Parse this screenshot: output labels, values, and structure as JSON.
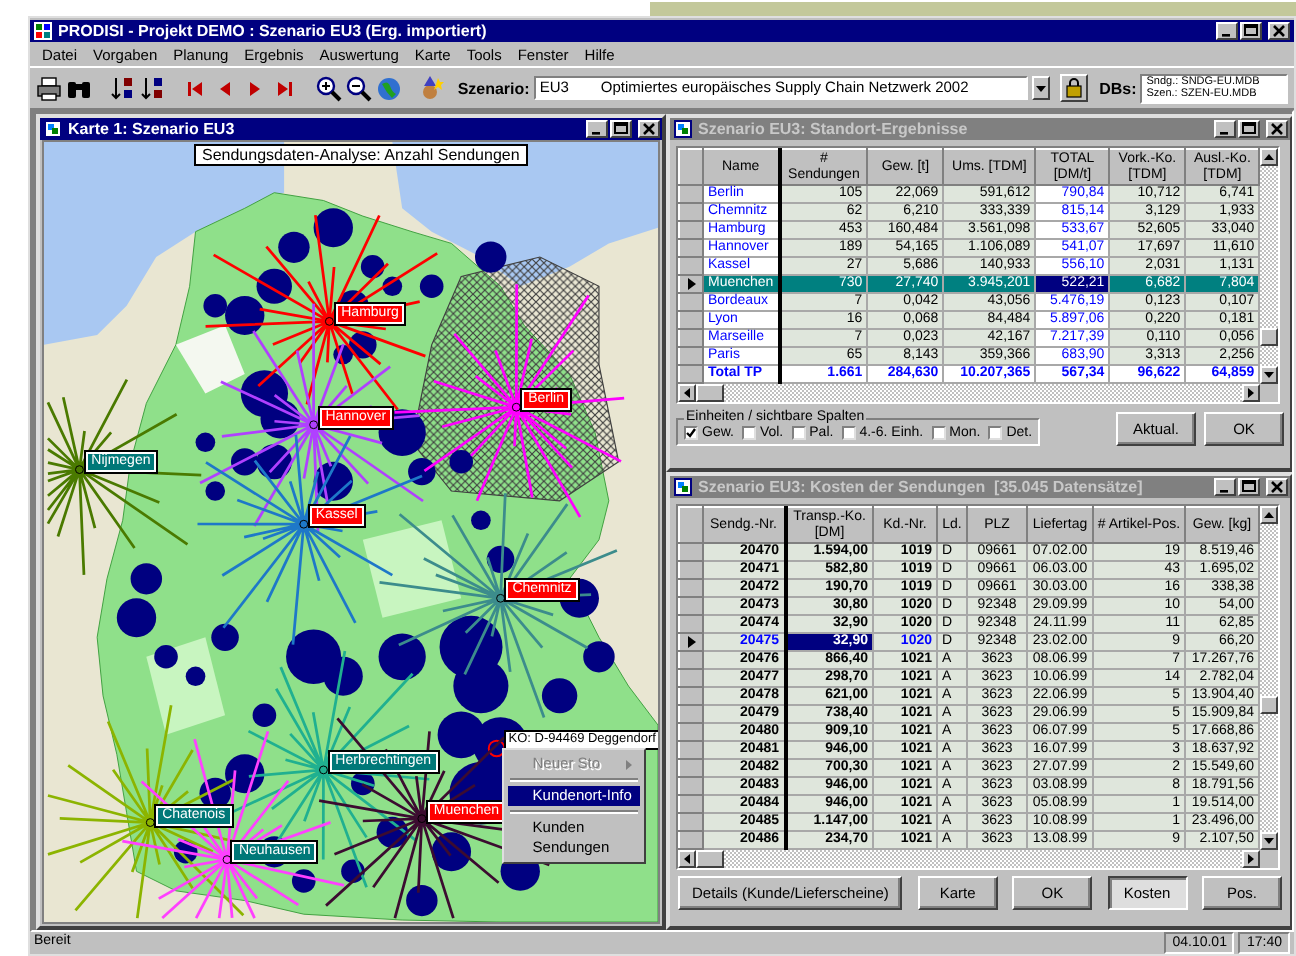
{
  "app": {
    "title": "PRODISI - Projekt DEMO : Szenario EU3 (Erg. importiert)"
  },
  "menu": [
    "Datei",
    "Vorgaben",
    "Planung",
    "Ergebnis",
    "Auswertung",
    "Karte",
    "Tools",
    "Fenster",
    "Hilfe"
  ],
  "toolbar": {
    "scenario_label": "Szenario:",
    "scenario_code": "EU3",
    "scenario_name": "Optimiertes europäisches Supply Chain Netzwerk 2002",
    "db_label": "DBs:",
    "db_files": [
      "Sndg.: SNDG-EU.MDB",
      "Szen.: SZEN-EU.MDB"
    ]
  },
  "map_window": {
    "title": "Karte 1: Szenario EU3",
    "active": true,
    "caption": "Sendungsdaten-Analyse: Anzahl Sendungen",
    "hubs": [
      {
        "label": "Hamburg",
        "kind": "depot",
        "color": "#ff0000"
      },
      {
        "label": "Berlin",
        "kind": "depot",
        "color": "#ff00ff"
      },
      {
        "label": "Hannover",
        "kind": "depot",
        "color": "#b040ff"
      },
      {
        "label": "Nijmegen",
        "kind": "plant",
        "color": "#4a7a00"
      },
      {
        "label": "Kassel",
        "kind": "depot",
        "color": "#1e78c8"
      },
      {
        "label": "Chemnitz",
        "kind": "depot",
        "color": "#3c8c8c"
      },
      {
        "label": "Herbrechtingen",
        "kind": "plant",
        "color": "#20b090"
      },
      {
        "label": "Chatenois",
        "kind": "plant",
        "color": "#8cb400"
      },
      {
        "label": "Neuhausen",
        "kind": "plant",
        "color": "#ff40ff"
      },
      {
        "label": "Muenchen",
        "kind": "depot",
        "color": "#3c0c30"
      }
    ],
    "tooltip": "KO: D-94469 Deggendorf",
    "context_menu": [
      [
        {
          "label": "Neuer Sto",
          "disabled": true,
          "submenu": true,
          "selected": false
        }
      ],
      [
        {
          "label": "Kundenort-Info",
          "disabled": false,
          "submenu": false,
          "selected": true
        }
      ],
      [
        {
          "label": "Kunden",
          "disabled": false,
          "submenu": false,
          "selected": false
        },
        {
          "label": "Sendungen",
          "disabled": false,
          "submenu": false,
          "selected": false
        }
      ]
    ]
  },
  "results_window": {
    "title": "Szenario EU3: Standort-Ergebnisse",
    "active": false,
    "grid": {
      "kind": "row_highlight",
      "columns": [
        {
          "label": "Name",
          "kind": "name",
          "frozen": true,
          "focused": false
        },
        {
          "label": "# Sendungen",
          "kind": "number",
          "frozen": false,
          "focused": false
        },
        {
          "label": "Gew. [t]",
          "kind": "number",
          "frozen": false,
          "focused": false
        },
        {
          "label": "Ums. [TDM]",
          "kind": "number",
          "frozen": false,
          "focused": false
        },
        {
          "label": "TOTAL [DM/t]",
          "kind": "highlight",
          "frozen": false,
          "focused": true
        },
        {
          "label": "Vork.-Ko. [TDM]",
          "kind": "number",
          "frozen": false,
          "focused": false
        },
        {
          "label": "Ausl.-Ko. [TDM]",
          "kind": "number",
          "frozen": false,
          "focused": false
        }
      ],
      "rows": [
        {
          "kind": "data",
          "selected": false,
          "cells": [
            "Berlin",
            "105",
            "22,069",
            "591,612",
            "790,84",
            "10,712",
            "6,741"
          ]
        },
        {
          "kind": "data",
          "selected": false,
          "cells": [
            "Chemnitz",
            "62",
            "6,210",
            "333,339",
            "815,14",
            "3,129",
            "1,933"
          ]
        },
        {
          "kind": "data",
          "selected": false,
          "cells": [
            "Hamburg",
            "453",
            "160,484",
            "3.561,098",
            "533,67",
            "52,605",
            "33,040"
          ]
        },
        {
          "kind": "data",
          "selected": false,
          "cells": [
            "Hannover",
            "189",
            "54,165",
            "1.106,089",
            "541,07",
            "17,697",
            "11,610"
          ]
        },
        {
          "kind": "data",
          "selected": false,
          "cells": [
            "Kassel",
            "27",
            "5,686",
            "140,933",
            "556,10",
            "2,031",
            "1,131"
          ]
        },
        {
          "kind": "data",
          "selected": true,
          "cells": [
            "Muenchen",
            "730",
            "27,740",
            "3.945,201",
            "522,21",
            "6,682",
            "7,804"
          ]
        },
        {
          "kind": "data",
          "selected": false,
          "cells": [
            "Bordeaux",
            "7",
            "0,042",
            "43,056",
            "5.476,19",
            "0,123",
            "0,107"
          ]
        },
        {
          "kind": "data",
          "selected": false,
          "cells": [
            "Lyon",
            "16",
            "0,068",
            "84,484",
            "5.897,06",
            "0,220",
            "0,181"
          ]
        },
        {
          "kind": "data",
          "selected": false,
          "cells": [
            "Marseille",
            "7",
            "0,023",
            "42,167",
            "7.217,39",
            "0,110",
            "0,056"
          ]
        },
        {
          "kind": "data",
          "selected": false,
          "cells": [
            "Paris",
            "65",
            "8,143",
            "359,366",
            "683,90",
            "3,313",
            "2,256"
          ]
        },
        {
          "kind": "total",
          "selected": false,
          "cells": [
            "Total TP",
            "1.661",
            "284,630",
            "10.207,365",
            "567,34",
            "96,622",
            "64,859"
          ]
        }
      ]
    },
    "options_label": "Einheiten / sichtbare Spalten",
    "options": [
      {
        "label": "Gew.",
        "checked": true
      },
      {
        "label": "Vol.",
        "checked": false
      },
      {
        "label": "Pal.",
        "checked": false
      },
      {
        "label": "4.-6. Einh.",
        "checked": false
      },
      {
        "label": "Mon.",
        "checked": false
      },
      {
        "label": "Det.",
        "checked": false
      }
    ],
    "buttons": [
      {
        "label": "Aktual.",
        "pressed": false
      },
      {
        "label": "OK",
        "pressed": false
      }
    ]
  },
  "shipments_window": {
    "title": "Szenario EU3: Kosten der Sendungen  [35.045 Datensätze]",
    "active": false,
    "grid": {
      "kind": "cell_marker",
      "columns": [
        {
          "label": "Sendg.-Nr.",
          "kind": "key",
          "frozen": true,
          "focused": false
        },
        {
          "label": "Transp.-Ko. [DM]",
          "kind": "key",
          "frozen": false,
          "focused": true
        },
        {
          "label": "Kd.-Nr.",
          "kind": "key",
          "frozen": false,
          "focused": false
        },
        {
          "label": "Ld.",
          "kind": "text",
          "frozen": false,
          "focused": false
        },
        {
          "label": "PLZ",
          "kind": "center",
          "frozen": false,
          "focused": false
        },
        {
          "label": "Liefertag",
          "kind": "center",
          "frozen": false,
          "focused": false
        },
        {
          "label": "# Artikel-Pos.",
          "kind": "number",
          "frozen": false,
          "focused": false
        },
        {
          "label": "Gew. [kg]",
          "kind": "number",
          "frozen": false,
          "focused": false
        }
      ],
      "rows": [
        {
          "kind": "data",
          "selected": false,
          "cells": [
            "20470",
            "1.594,00",
            "1019",
            "D",
            "09661",
            "07.02.00",
            "19",
            "8.519,46"
          ]
        },
        {
          "kind": "data",
          "selected": false,
          "cells": [
            "20471",
            "582,80",
            "1019",
            "D",
            "09661",
            "06.03.00",
            "43",
            "1.695,02"
          ]
        },
        {
          "kind": "data",
          "selected": false,
          "cells": [
            "20472",
            "190,70",
            "1019",
            "D",
            "09661",
            "30.03.00",
            "16",
            "338,38"
          ]
        },
        {
          "kind": "data",
          "selected": false,
          "cells": [
            "20473",
            "30,80",
            "1020",
            "D",
            "92348",
            "29.09.99",
            "10",
            "54,00"
          ]
        },
        {
          "kind": "data",
          "selected": false,
          "cells": [
            "20474",
            "32,90",
            "1020",
            "D",
            "92348",
            "24.11.99",
            "11",
            "62,85"
          ]
        },
        {
          "kind": "data",
          "selected": true,
          "cells": [
            "20475",
            "32,90",
            "1020",
            "D",
            "92348",
            "23.02.00",
            "9",
            "66,20"
          ]
        },
        {
          "kind": "data",
          "selected": false,
          "cells": [
            "20476",
            "866,40",
            "1021",
            "A",
            "3623",
            "08.06.99",
            "7",
            "17.267,76"
          ]
        },
        {
          "kind": "data",
          "selected": false,
          "cells": [
            "20477",
            "298,70",
            "1021",
            "A",
            "3623",
            "10.06.99",
            "14",
            "2.782,04"
          ]
        },
        {
          "kind": "data",
          "selected": false,
          "cells": [
            "20478",
            "621,00",
            "1021",
            "A",
            "3623",
            "22.06.99",
            "5",
            "13.904,40"
          ]
        },
        {
          "kind": "data",
          "selected": false,
          "cells": [
            "20479",
            "738,40",
            "1021",
            "A",
            "3623",
            "29.06.99",
            "5",
            "15.909,84"
          ]
        },
        {
          "kind": "data",
          "selected": false,
          "cells": [
            "20480",
            "909,10",
            "1021",
            "A",
            "3623",
            "06.07.99",
            "5",
            "17.668,86"
          ]
        },
        {
          "kind": "data",
          "selected": false,
          "cells": [
            "20481",
            "946,00",
            "1021",
            "A",
            "3623",
            "16.07.99",
            "3",
            "18.637,92"
          ]
        },
        {
          "kind": "data",
          "selected": false,
          "cells": [
            "20482",
            "700,30",
            "1021",
            "A",
            "3623",
            "27.07.99",
            "2",
            "15.549,60"
          ]
        },
        {
          "kind": "data",
          "selected": false,
          "cells": [
            "20483",
            "946,00",
            "1021",
            "A",
            "3623",
            "03.08.99",
            "8",
            "18.791,56"
          ]
        },
        {
          "kind": "data",
          "selected": false,
          "cells": [
            "20484",
            "946,00",
            "1021",
            "A",
            "3623",
            "05.08.99",
            "1",
            "19.514,00"
          ]
        },
        {
          "kind": "data",
          "selected": false,
          "cells": [
            "20485",
            "1.147,00",
            "1021",
            "A",
            "3623",
            "10.08.99",
            "1",
            "23.496,00"
          ]
        },
        {
          "kind": "data",
          "selected": false,
          "cells": [
            "20486",
            "234,70",
            "1021",
            "A",
            "3623",
            "13.08.99",
            "9",
            "2.107,50"
          ]
        }
      ]
    },
    "buttons": [
      {
        "label": "Details (Kunde/Lieferscheine)",
        "pressed": false
      },
      {
        "label": "Karte",
        "pressed": false
      },
      {
        "label": "OK",
        "pressed": false
      },
      {
        "label": "Kosten",
        "pressed": true
      },
      {
        "label": "Pos.",
        "pressed": false
      }
    ]
  },
  "status_bar": {
    "text": "Bereit",
    "date": "04.10.01",
    "time": "17:40"
  }
}
